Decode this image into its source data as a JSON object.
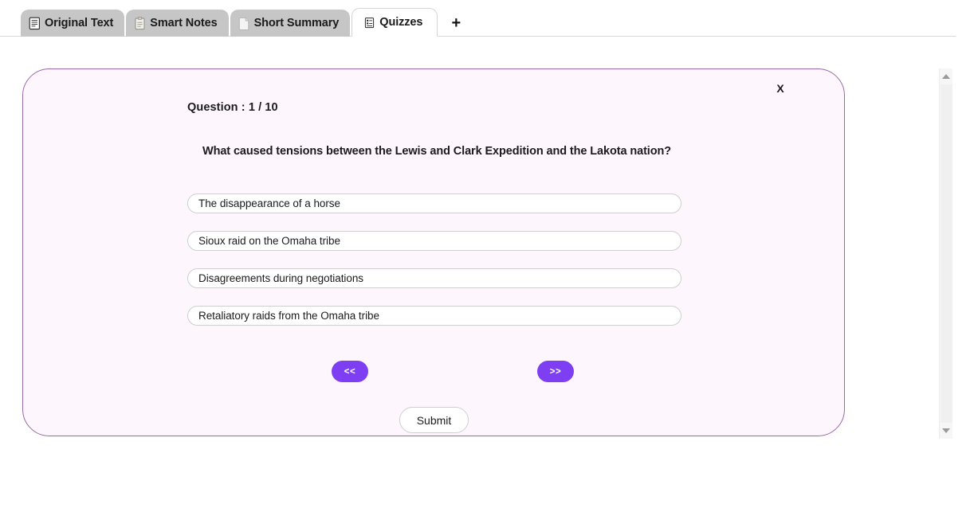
{
  "tabs": {
    "items": [
      {
        "label": "Original Text",
        "icon": "document-lines-icon",
        "active": false
      },
      {
        "label": "Smart Notes",
        "icon": "clipboard-icon",
        "active": false
      },
      {
        "label": "Short Summary",
        "icon": "page-icon",
        "active": false
      },
      {
        "label": "Quizzes",
        "icon": "quiz-list-icon",
        "active": true
      }
    ],
    "add_tab_label": "+"
  },
  "quiz": {
    "close_label": "X",
    "counter": "Question : 1 / 10",
    "question_number": 1,
    "question_total": 10,
    "question": "What caused tensions between the Lewis and Clark Expedition and the Lakota nation?",
    "options": [
      "The disappearance of a horse",
      "Sioux raid on the Omaha tribe",
      "Disagreements during negotiations",
      "Retaliatory raids from the Omaha tribe"
    ],
    "selected_option": null,
    "prev_label": "<<",
    "next_label": ">>",
    "submit_label": "Submit"
  },
  "colors": {
    "accent_purple": "#7e3ff2",
    "card_border": "#9b6aa8",
    "card_background": "#fdf6fd",
    "tab_inactive": "#c6c6c6",
    "tab_active": "#ffffff",
    "option_border": "#cfcfcf",
    "text": "#1b1b1d"
  },
  "scrollbar": {
    "up_arrow": "scroll-up-arrow",
    "down_arrow": "scroll-down-arrow",
    "orientation": "vertical"
  }
}
